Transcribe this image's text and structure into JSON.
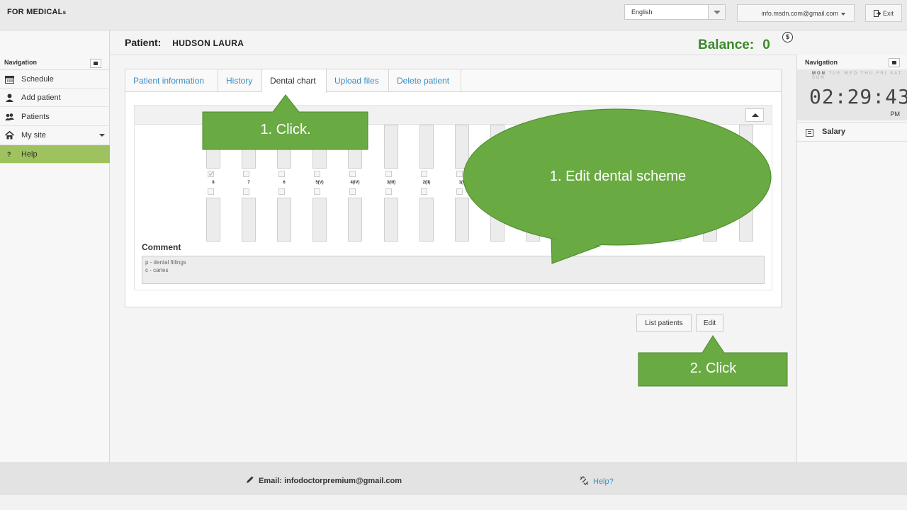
{
  "app": {
    "logo_main": "FOR MEDICAL",
    "logo_suffix": "s"
  },
  "topbar": {
    "language": "English",
    "user_email": "info.msdn.com@gmail.com",
    "exit_label": "Exit"
  },
  "patient": {
    "label": "Patient:",
    "name": "HUDSON LAURA"
  },
  "balance": {
    "label": "Balance:",
    "value": "0",
    "currency_symbol": "$"
  },
  "left_nav": {
    "title": "Navigation",
    "items": [
      {
        "label": "Schedule",
        "icon": "calendar-icon"
      },
      {
        "label": "Add patient",
        "icon": "user-icon"
      },
      {
        "label": "Patients",
        "icon": "users-icon"
      },
      {
        "label": "My site",
        "icon": "home-icon"
      },
      {
        "label": "Help",
        "icon": "question-icon",
        "active": true
      }
    ]
  },
  "right_nav": {
    "title": "Navigation",
    "days": [
      "MON",
      "TUE",
      "WED",
      "THU",
      "FRI",
      "SAT",
      "SUN"
    ],
    "clock": {
      "time": "02:29:43",
      "ampm": "PM"
    },
    "salary_label": "Salary"
  },
  "tabs": [
    {
      "label": "Patient information"
    },
    {
      "label": "History"
    },
    {
      "label": "Dental chart",
      "active": true
    },
    {
      "label": "Upload files"
    },
    {
      "label": "Delete patient"
    }
  ],
  "dental_chart": {
    "tooth_numbers": [
      "8",
      "7",
      "6",
      "5(V)",
      "4(IV)",
      "3(III)",
      "2(II)",
      "1(I)"
    ],
    "checked_first": true
  },
  "comment": {
    "label": "Comment",
    "value": "p - dental fillings\nc - caries"
  },
  "actions": {
    "list_patients": "List patients",
    "edit": "Edit"
  },
  "callouts": {
    "click1": "1. Click.",
    "edit_scheme": "1. Edit dental scheme",
    "click2": "2. Click"
  },
  "footer": {
    "email_label": "Email:",
    "email": "infodoctorpremium@gmail.com",
    "help": "Help?"
  },
  "colors": {
    "accent_green": "#6aaa43",
    "balance_green": "#3a8a2a",
    "link_blue": "#3b8ec2",
    "active_nav": "#9ec25e"
  }
}
